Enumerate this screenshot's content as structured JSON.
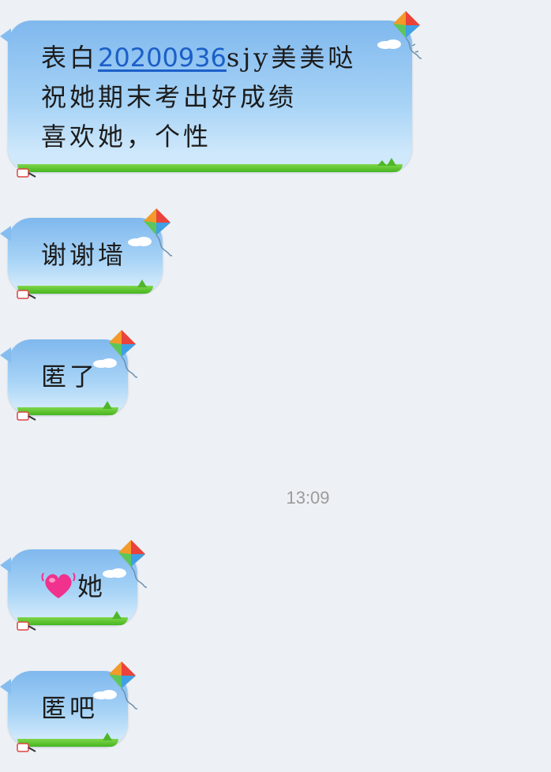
{
  "messages": [
    {
      "id": "msg1",
      "lines": [
        {
          "prefix": "表白",
          "link": "20200936",
          "suffix": "sjy美美哒"
        },
        {
          "text": "祝她期末考出好成绩"
        },
        {
          "text": "喜欢她，个性"
        }
      ]
    },
    {
      "id": "msg2",
      "text": "谢谢墙"
    },
    {
      "id": "msg3",
      "text": "匿了"
    },
    {
      "id": "msg4",
      "emoji": "heart-icon",
      "text": "她"
    },
    {
      "id": "msg5",
      "text": "匿吧"
    }
  ],
  "timestamp": "13:09",
  "bubble_theme": {
    "sky_top": "#7fb8ee",
    "sky_bottom": "#cfe8fb",
    "grass": "#46b51f",
    "icons": [
      "kite-icon",
      "cloud-icon",
      "spool-icon"
    ]
  }
}
